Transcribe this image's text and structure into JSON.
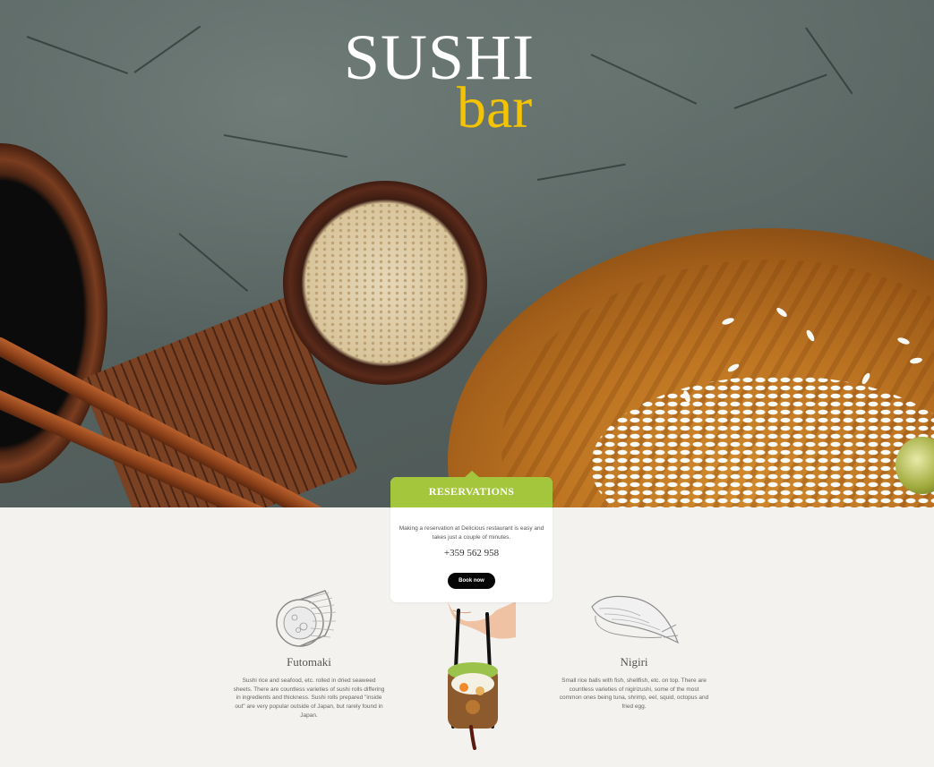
{
  "logo": {
    "title": "SUSHI",
    "subtitle": "bar"
  },
  "reservations": {
    "title": "RESERVATIONS",
    "description": "Making a reservation at Delicious restaurant is easy and takes just a couple of minutes.",
    "phone": "+359 562 958",
    "button_label": "Book now",
    "accent_color": "#a3c63c"
  },
  "features": [
    {
      "title": "Futomaki",
      "description": "Sushi rice and seafood, etc. rolled in dried seaweed sheets. There are countless varieties of sushi rolls differing in ingredients and thickness. Sushi rolls prepared \"inside out\" are very popular outside of Japan, but rarely found in Japan.",
      "icon": "futomaki-roll-icon"
    },
    {
      "title": "Nigiri",
      "description": "Small rice balls with fish, shellfish, etc. on top. There are countless varieties of nigirizushi, some of the most common ones being tuna, shrimp, eel, squid, octopus and fried egg.",
      "icon": "nigiri-icon"
    }
  ],
  "colors": {
    "logo_accent": "#f5c400",
    "button": "#050505",
    "background": "#f3f2ef"
  }
}
